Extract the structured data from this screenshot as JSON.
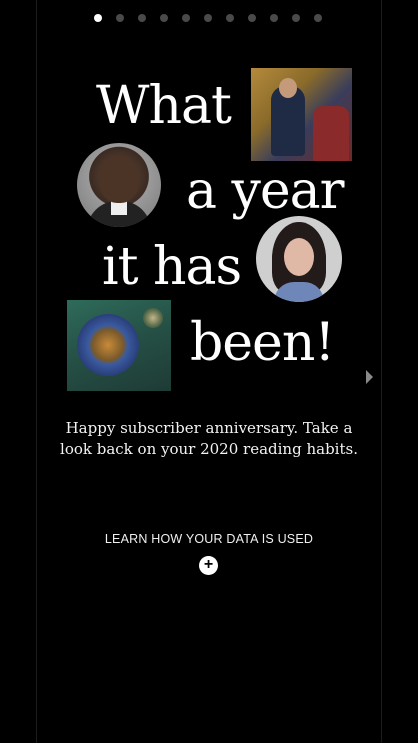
{
  "pagination": {
    "total": 11,
    "active_index": 0
  },
  "headline": {
    "word1": "What",
    "word2": "a year",
    "word3": "it has",
    "word4": "been!"
  },
  "subtitle": "Happy subscriber anniversary. Take a look back on your 2020 reading habits.",
  "learn_link": "LEARN HOW YOUR DATA IS USED",
  "plus_glyph": "+",
  "colors": {
    "background": "#000000",
    "text": "#ffffff",
    "dot_inactive": "#4a4a4a",
    "dot_active": "#ffffff"
  },
  "icons": {
    "next": "chevron-right-icon",
    "expand": "plus-icon"
  }
}
